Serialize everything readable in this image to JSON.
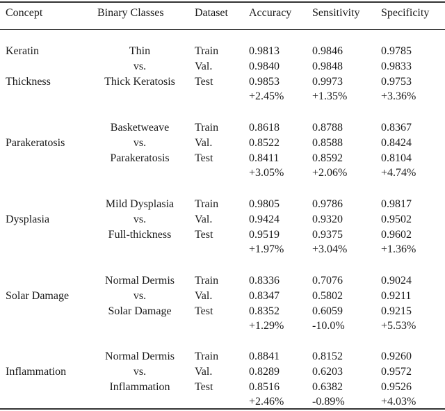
{
  "headers": [
    "Concept",
    "Binary Classes",
    "Dataset",
    "Accuracy",
    "Sensitivity",
    "Specificity"
  ],
  "groups": [
    {
      "concept": [
        "Keratin",
        "Thickness"
      ],
      "classes": [
        "Thin",
        "vs.",
        "Thick Keratosis"
      ],
      "rows": [
        {
          "dataset": "Train",
          "accuracy": "0.9813",
          "sensitivity": "0.9846",
          "specificity": "0.9785"
        },
        {
          "dataset": "Val.",
          "accuracy": "0.9840",
          "sensitivity": "0.9848",
          "specificity": "0.9833"
        },
        {
          "dataset": "Test",
          "accuracy": "0.9853",
          "sensitivity": "0.9973",
          "specificity": "0.9753"
        }
      ],
      "delta": {
        "accuracy": "+2.45%",
        "sensitivity": "+1.35%",
        "specificity": "+3.36%"
      }
    },
    {
      "concept": [
        "Parakeratosis"
      ],
      "classes": [
        "Basketweave",
        "vs.",
        "Parakeratosis"
      ],
      "rows": [
        {
          "dataset": "Train",
          "accuracy": "0.8618",
          "sensitivity": "0.8788",
          "specificity": "0.8367"
        },
        {
          "dataset": "Val.",
          "accuracy": "0.8522",
          "sensitivity": "0.8588",
          "specificity": "0.8424"
        },
        {
          "dataset": "Test",
          "accuracy": "0.8411",
          "sensitivity": "0.8592",
          "specificity": "0.8104"
        }
      ],
      "delta": {
        "accuracy": "+3.05%",
        "sensitivity": "+2.06%",
        "specificity": "+4.74%"
      }
    },
    {
      "concept": [
        "Dysplasia"
      ],
      "classes": [
        "Mild Dysplasia",
        "vs.",
        "Full-thickness"
      ],
      "rows": [
        {
          "dataset": "Train",
          "accuracy": "0.9805",
          "sensitivity": "0.9786",
          "specificity": "0.9817"
        },
        {
          "dataset": "Val.",
          "accuracy": "0.9424",
          "sensitivity": "0.9320",
          "specificity": "0.9502"
        },
        {
          "dataset": "Test",
          "accuracy": "0.9519",
          "sensitivity": "0.9375",
          "specificity": "0.9602"
        }
      ],
      "delta": {
        "accuracy": "+1.97%",
        "sensitivity": "+3.04%",
        "specificity": "+1.36%"
      }
    },
    {
      "concept": [
        "Solar Damage"
      ],
      "classes": [
        "Normal Dermis",
        "vs.",
        "Solar Damage"
      ],
      "rows": [
        {
          "dataset": "Train",
          "accuracy": "0.8336",
          "sensitivity": "0.7076",
          "specificity": "0.9024"
        },
        {
          "dataset": "Val.",
          "accuracy": "0.8347",
          "sensitivity": "0.5802",
          "specificity": "0.9211"
        },
        {
          "dataset": "Test",
          "accuracy": "0.8352",
          "sensitivity": "0.6059",
          "specificity": "0.9215"
        }
      ],
      "delta": {
        "accuracy": "+1.29%",
        "sensitivity": "-10.0%",
        "specificity": "+5.53%"
      }
    },
    {
      "concept": [
        "Inflammation"
      ],
      "classes": [
        "Normal Dermis",
        "vs.",
        "Inflammation"
      ],
      "rows": [
        {
          "dataset": "Train",
          "accuracy": "0.8841",
          "sensitivity": "0.8152",
          "specificity": "0.9260"
        },
        {
          "dataset": "Val.",
          "accuracy": "0.8289",
          "sensitivity": "0.6203",
          "specificity": "0.9572"
        },
        {
          "dataset": "Test",
          "accuracy": "0.8516",
          "sensitivity": "0.6382",
          "specificity": "0.9526"
        }
      ],
      "delta": {
        "accuracy": "+2.46%",
        "sensitivity": "-0.89%",
        "specificity": "+4.03%"
      }
    }
  ]
}
